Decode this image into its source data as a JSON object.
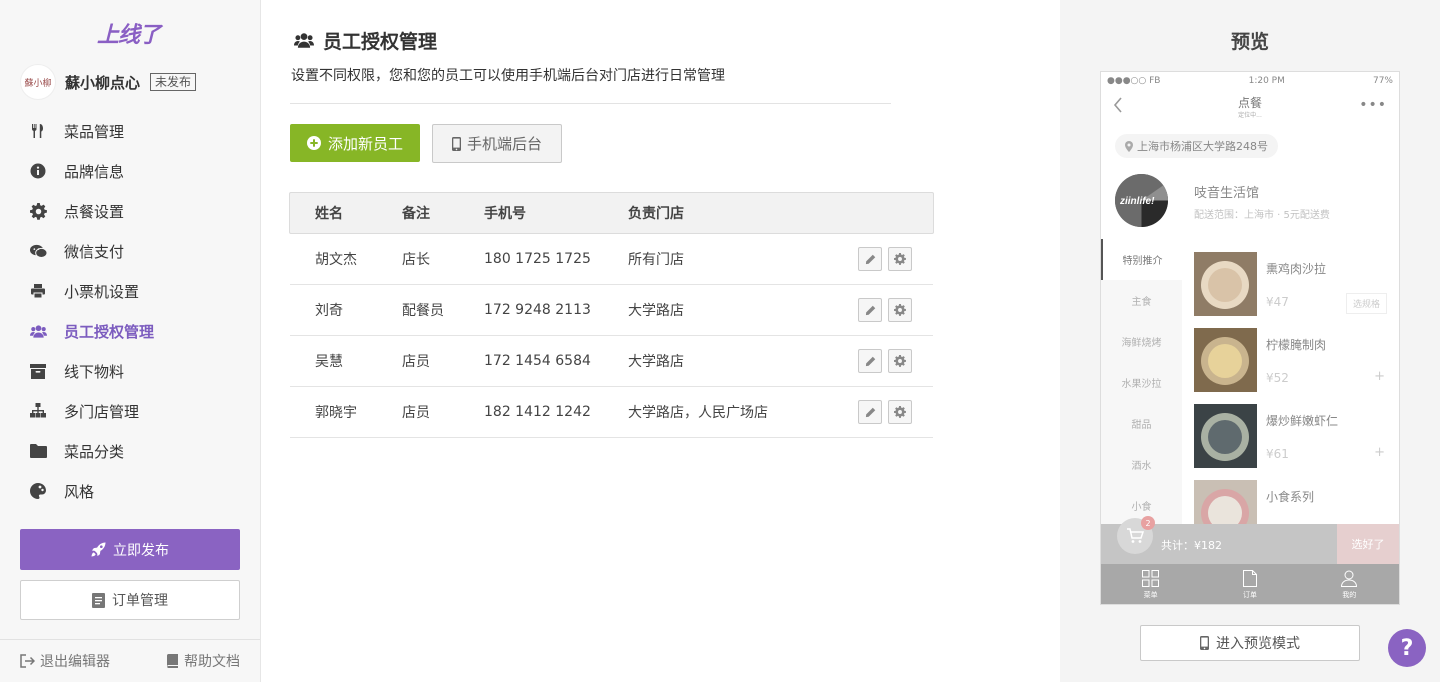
{
  "brand": {
    "logo_text": "上线了",
    "accent": "#8a63c2",
    "green": "#87b626"
  },
  "shop": {
    "avatar_text": "蘇小柳",
    "name": "蘇小柳点心",
    "status_badge": "未发布"
  },
  "sidebar": {
    "items": [
      {
        "label": "菜品管理",
        "icon": "fork-knife-icon"
      },
      {
        "label": "品牌信息",
        "icon": "info-icon"
      },
      {
        "label": "点餐设置",
        "icon": "gear-icon"
      },
      {
        "label": "微信支付",
        "icon": "wechat-icon"
      },
      {
        "label": "小票机设置",
        "icon": "printer-icon"
      },
      {
        "label": "员工授权管理",
        "icon": "users-icon",
        "active": true
      },
      {
        "label": "线下物料",
        "icon": "archive-icon"
      },
      {
        "label": "多门店管理",
        "icon": "sitemap-icon"
      },
      {
        "label": "菜品分类",
        "icon": "folder-icon"
      },
      {
        "label": "风格",
        "icon": "palette-icon"
      }
    ],
    "publish_label": "立即发布",
    "orders_label": "订单管理",
    "exit_label": "退出编辑器",
    "help_docs_label": "帮助文档"
  },
  "main": {
    "title": "员工授权管理",
    "description": "设置不同权限，您和您的员工可以使用手机端后台对门店进行日常管理",
    "add_button": "添加新员工",
    "mobile_button": "手机端后台",
    "table": {
      "headers": [
        "姓名",
        "备注",
        "手机号",
        "负责门店"
      ],
      "rows": [
        {
          "name": "胡文杰",
          "note": "店长",
          "phone": "180 1725 1725",
          "store": "所有门店"
        },
        {
          "name": "刘奇",
          "note": "配餐员",
          "phone": "172 9248 2113",
          "store": "大学路店"
        },
        {
          "name": "吴慧",
          "note": "店员",
          "phone": "172 1454 6584",
          "store": "大学路店"
        },
        {
          "name": "郭晓宇",
          "note": "店员",
          "phone": "182 1412 1242",
          "store": "大学路店，人民广场店"
        }
      ]
    }
  },
  "preview": {
    "title": "预览",
    "phone": {
      "status_left": "●●●○○ FB",
      "status_time": "1:20 PM",
      "status_battery": "77%",
      "nav_title": "点餐",
      "nav_subtitle": "定位中...",
      "address": "上海市杨浦区大学路248号",
      "store_logo_text": "ziinlife!",
      "store_name": "吱音生活馆",
      "store_info": "配送范围：上海市 · 5元配送费",
      "categories": [
        "特别推介",
        "主食",
        "海鲜烧烤",
        "水果沙拉",
        "甜品",
        "酒水",
        "小食"
      ],
      "dishes": [
        {
          "name": "熏鸡肉沙拉",
          "price": "¥47",
          "option": "选规格"
        },
        {
          "name": "柠檬腌制肉",
          "price": "¥52"
        },
        {
          "name": "爆炒鲜嫩虾仁",
          "price": "¥61"
        },
        {
          "name": "小食系列",
          "price": ""
        }
      ],
      "cart_count": "2",
      "cart_total": "共计：¥182",
      "cart_ok": "选好了",
      "tabs": [
        "菜单",
        "订单",
        "我的"
      ]
    },
    "enter_button": "进入预览模式"
  },
  "help_button": "?"
}
